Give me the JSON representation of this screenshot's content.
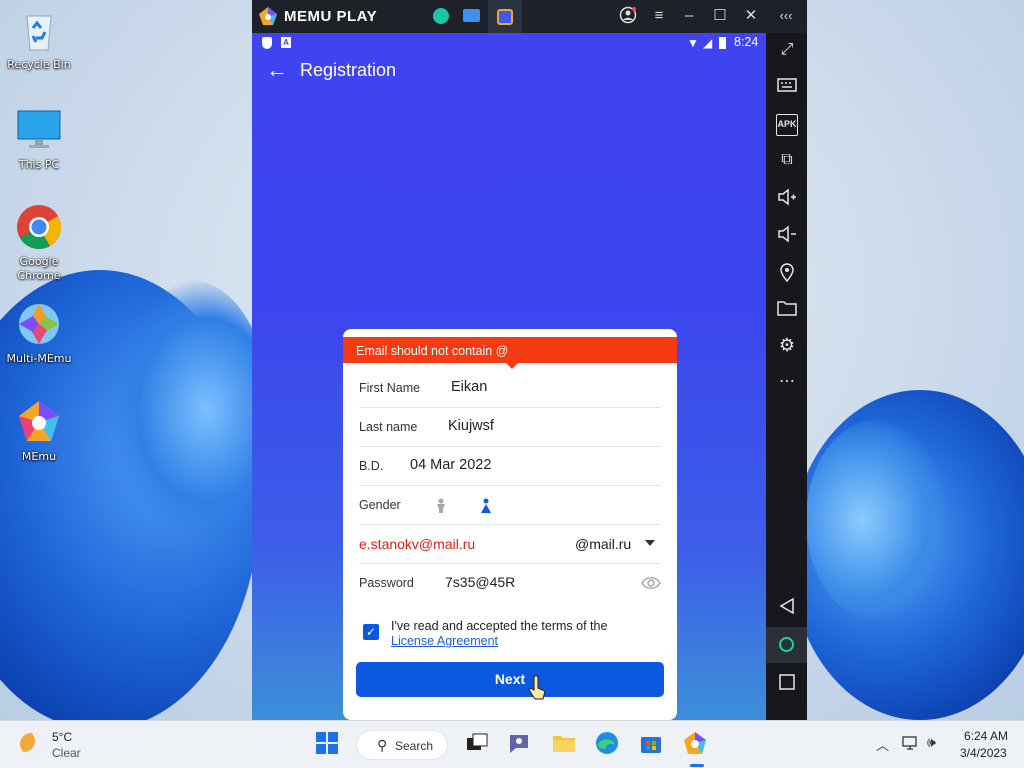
{
  "desktop": {
    "icons": [
      {
        "label": "Recycle Bin"
      },
      {
        "label": "This PC"
      },
      {
        "label": "Google Chrome"
      },
      {
        "label": "Multi-MEmu"
      },
      {
        "label": "MEmu"
      }
    ]
  },
  "emulator": {
    "brand": "MEMU PLAY",
    "status_time": "8:24",
    "app_title": "Registration",
    "card": {
      "error": "Email should not contain @",
      "first_name_label": "First Name",
      "first_name_value": "Eikan",
      "last_name_label": "Last name",
      "last_name_value": "Kiujwsf",
      "bd_label": "B.D.",
      "bd_value": "04 Mar 2022",
      "gender_label": "Gender",
      "email_value": "e.stanokv@mail.ru",
      "domain_value": "@mail.ru",
      "password_label": "Password",
      "password_value": "7s35@45R",
      "terms_text": "I've read and accepted the terms of the",
      "terms_link": "License Agreement",
      "next_label": "Next"
    },
    "colors": {
      "accent": "#0d58e0",
      "error": "#f43b12",
      "email_error_text": "#e0201b"
    }
  },
  "taskbar": {
    "weather_temp": "5°C",
    "weather_desc": "Clear",
    "search_label": "Search",
    "time": "6:24 AM",
    "date": "3/4/2023"
  }
}
